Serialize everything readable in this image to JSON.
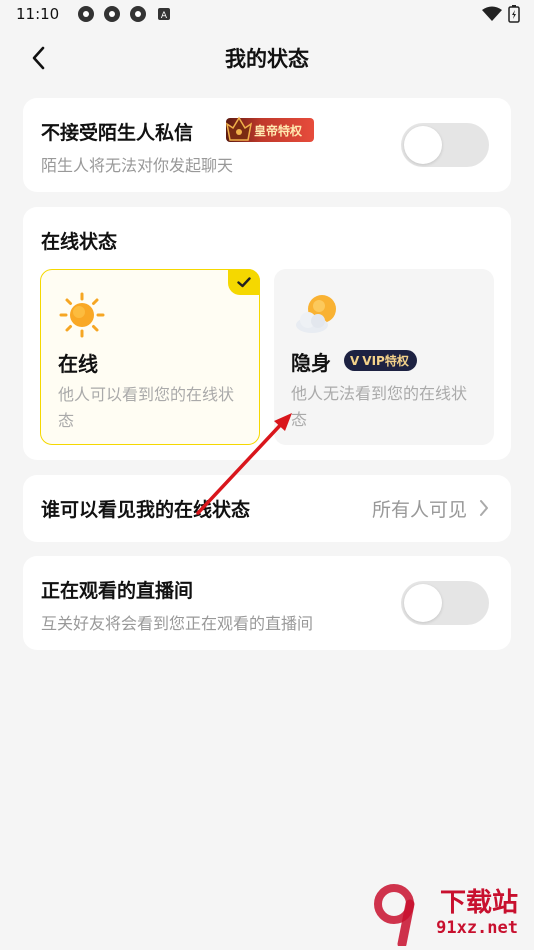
{
  "status_bar": {
    "time": "11:10"
  },
  "header": {
    "title": "我的状态"
  },
  "stranger_dm": {
    "title": "不接受陌生人私信",
    "badge": "皇帝特权",
    "subtitle": "陌生人将无法对你发起聊天",
    "enabled": false
  },
  "online_status": {
    "section_title": "在线状态",
    "options": [
      {
        "label": "在线",
        "desc": "他人可以看到您的在线状态",
        "selected": true
      },
      {
        "label": "隐身",
        "badge": "VIP特权",
        "desc": "他人无法看到您的在线状态",
        "selected": false
      }
    ]
  },
  "visibility": {
    "label": "谁可以看见我的在线状态",
    "value": "所有人可见"
  },
  "watching_live": {
    "title": "正在观看的直播间",
    "subtitle": "互关好友将会看到您正在观看的直播间",
    "enabled": false
  },
  "watermark": {
    "brand": "下载站",
    "site": "91xz.net"
  },
  "colors": {
    "accent": "#f5d800",
    "annotation_arrow": "#d9161c"
  }
}
